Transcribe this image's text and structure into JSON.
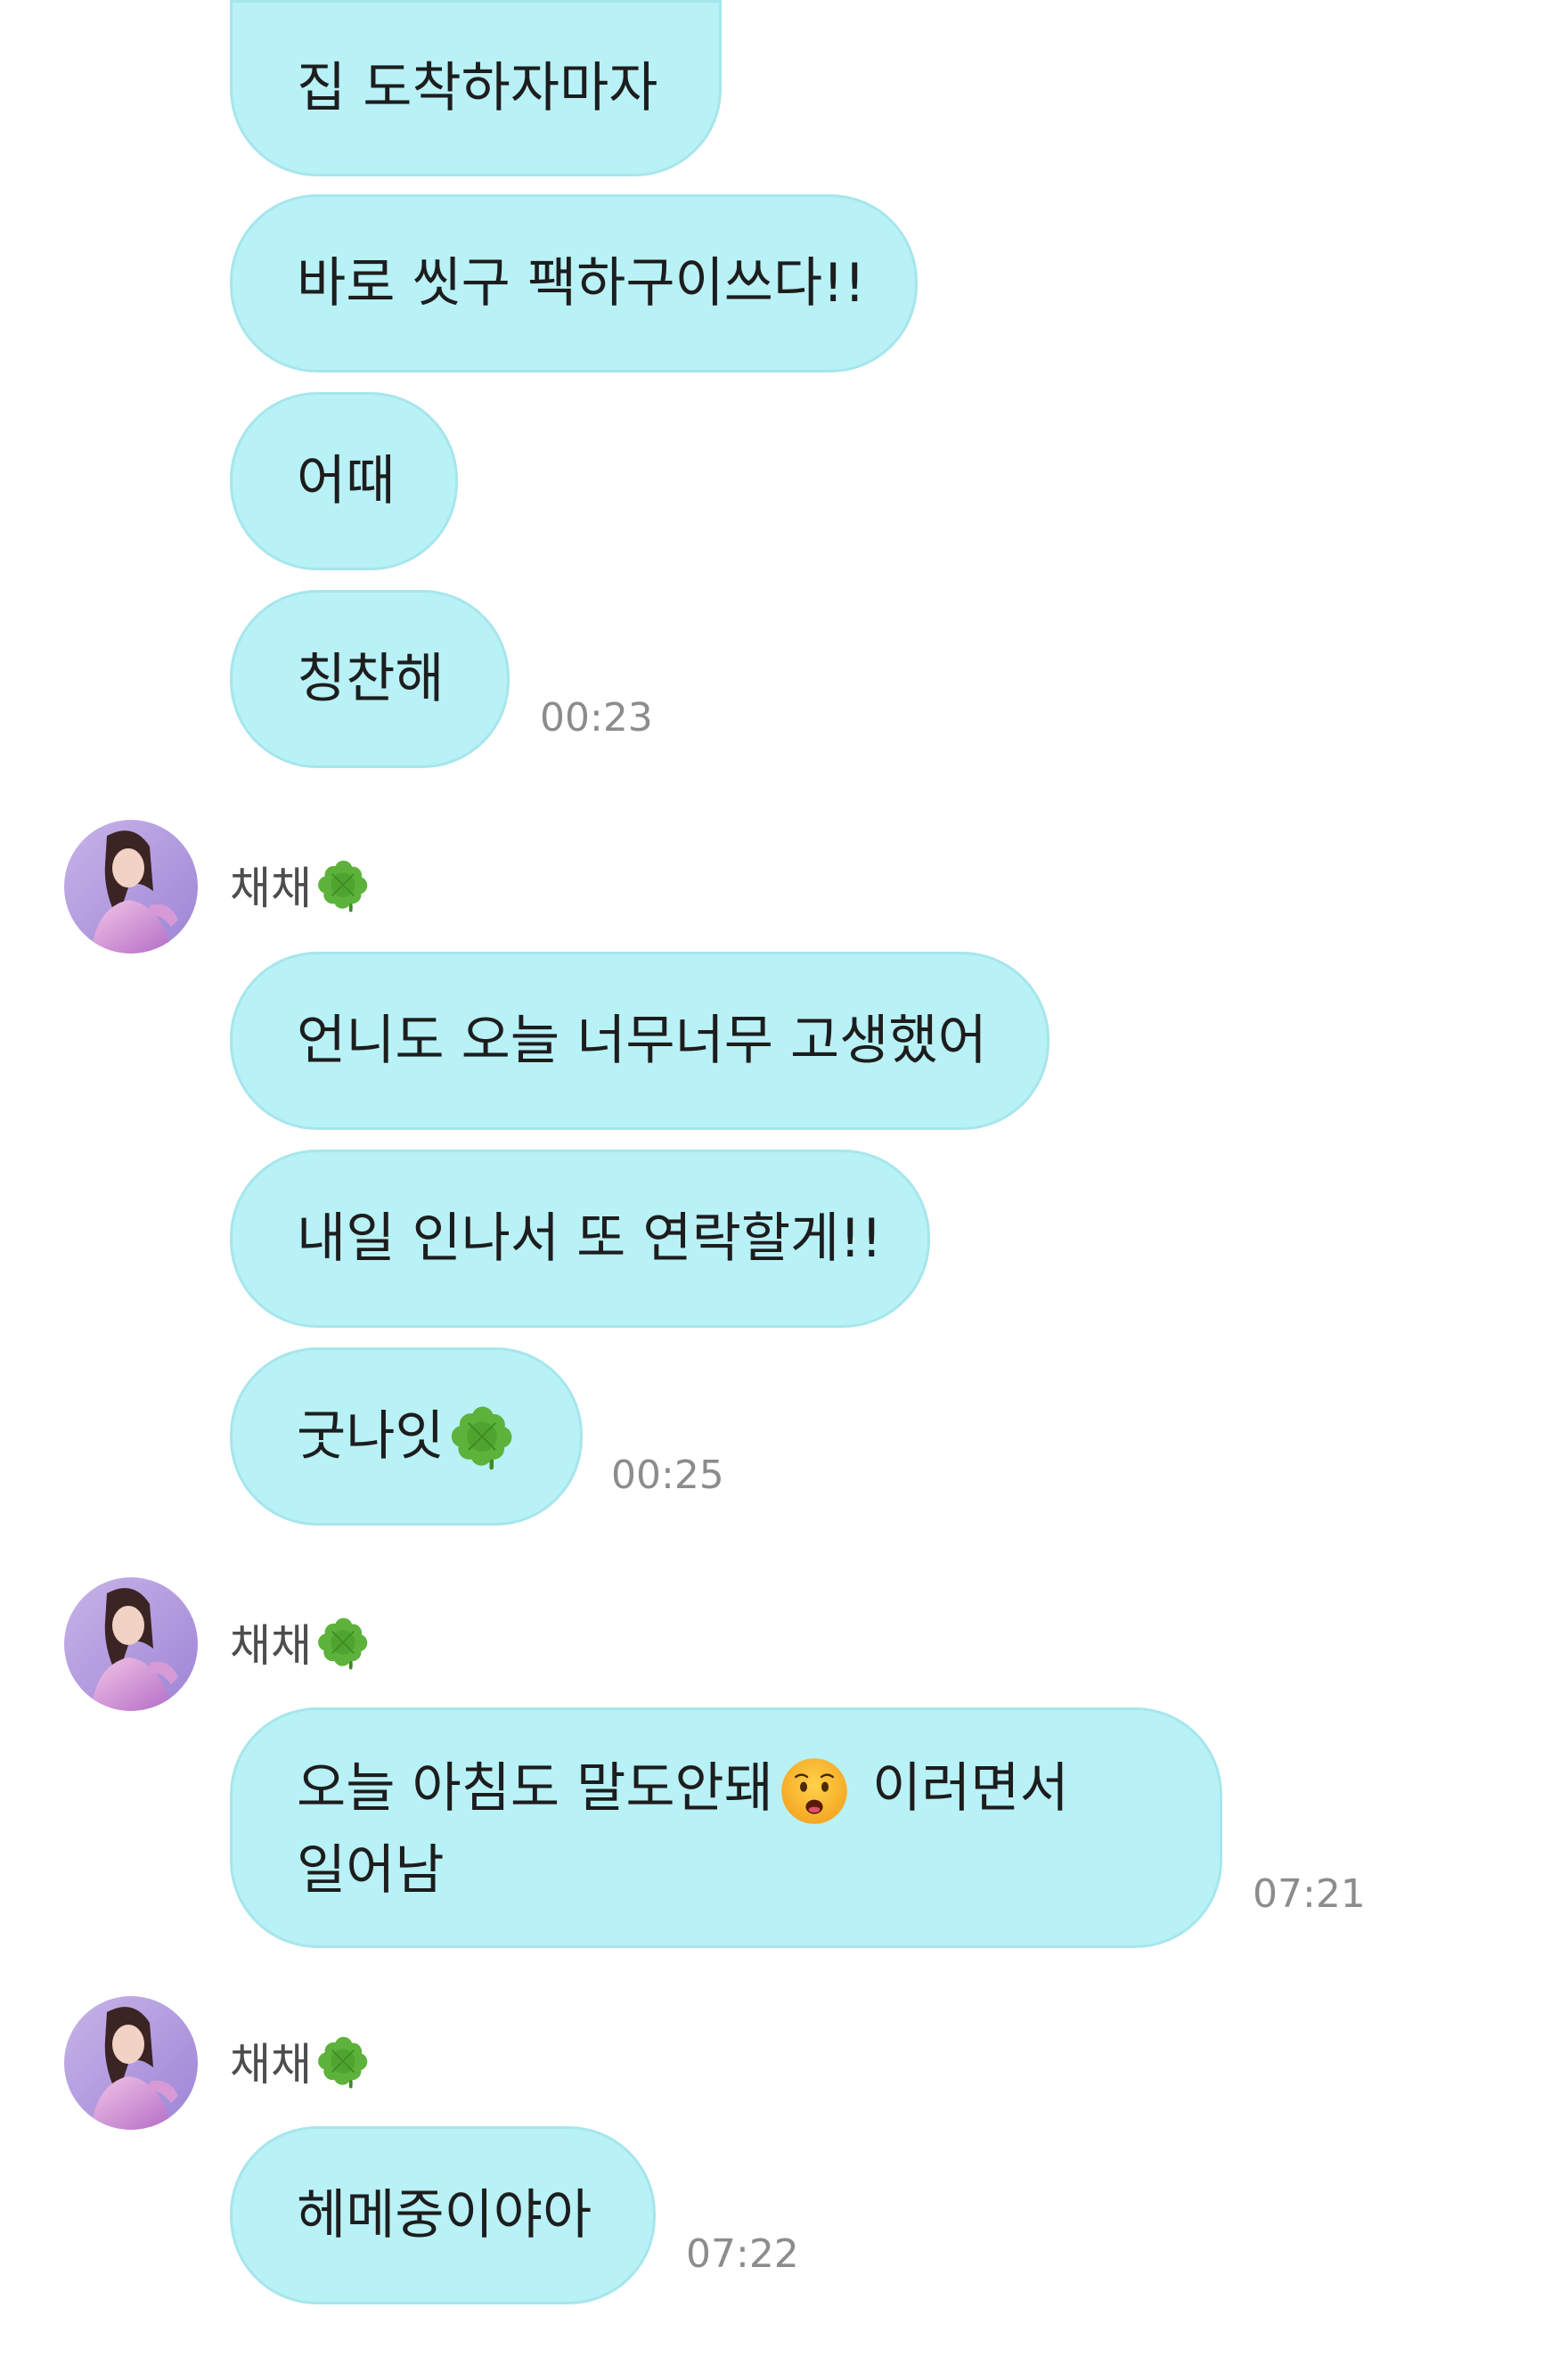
{
  "sender_name": "채채",
  "sender_icon": "four-leaf-clover-icon",
  "messages": [
    {
      "text": "집 도착하자마자"
    },
    {
      "text": "바로 씻구 팩하구이쓰다!!"
    },
    {
      "text": "어때"
    },
    {
      "text": "칭찬해",
      "time": "00:23"
    },
    {
      "text": "언니도 오늘 너무너무 고생했어"
    },
    {
      "text": "내일 인나서 또 연락할게!!"
    },
    {
      "text": "굿나잇",
      "emoji": "four-leaf-clover-icon",
      "time": "00:25"
    },
    {
      "text_before": "오늘 아침도 말도안돼",
      "emoji": "worried-face-icon",
      "text_after": " 이러면서",
      "line2": "일어남",
      "time": "07:21"
    },
    {
      "text": "헤메중이야아",
      "time": "07:22"
    }
  ],
  "colors": {
    "bubble": "#b8f1f6",
    "bubble_border": "#a6e6ec",
    "timestamp": "#8c8c8c",
    "sender": "#4d4d4d"
  }
}
